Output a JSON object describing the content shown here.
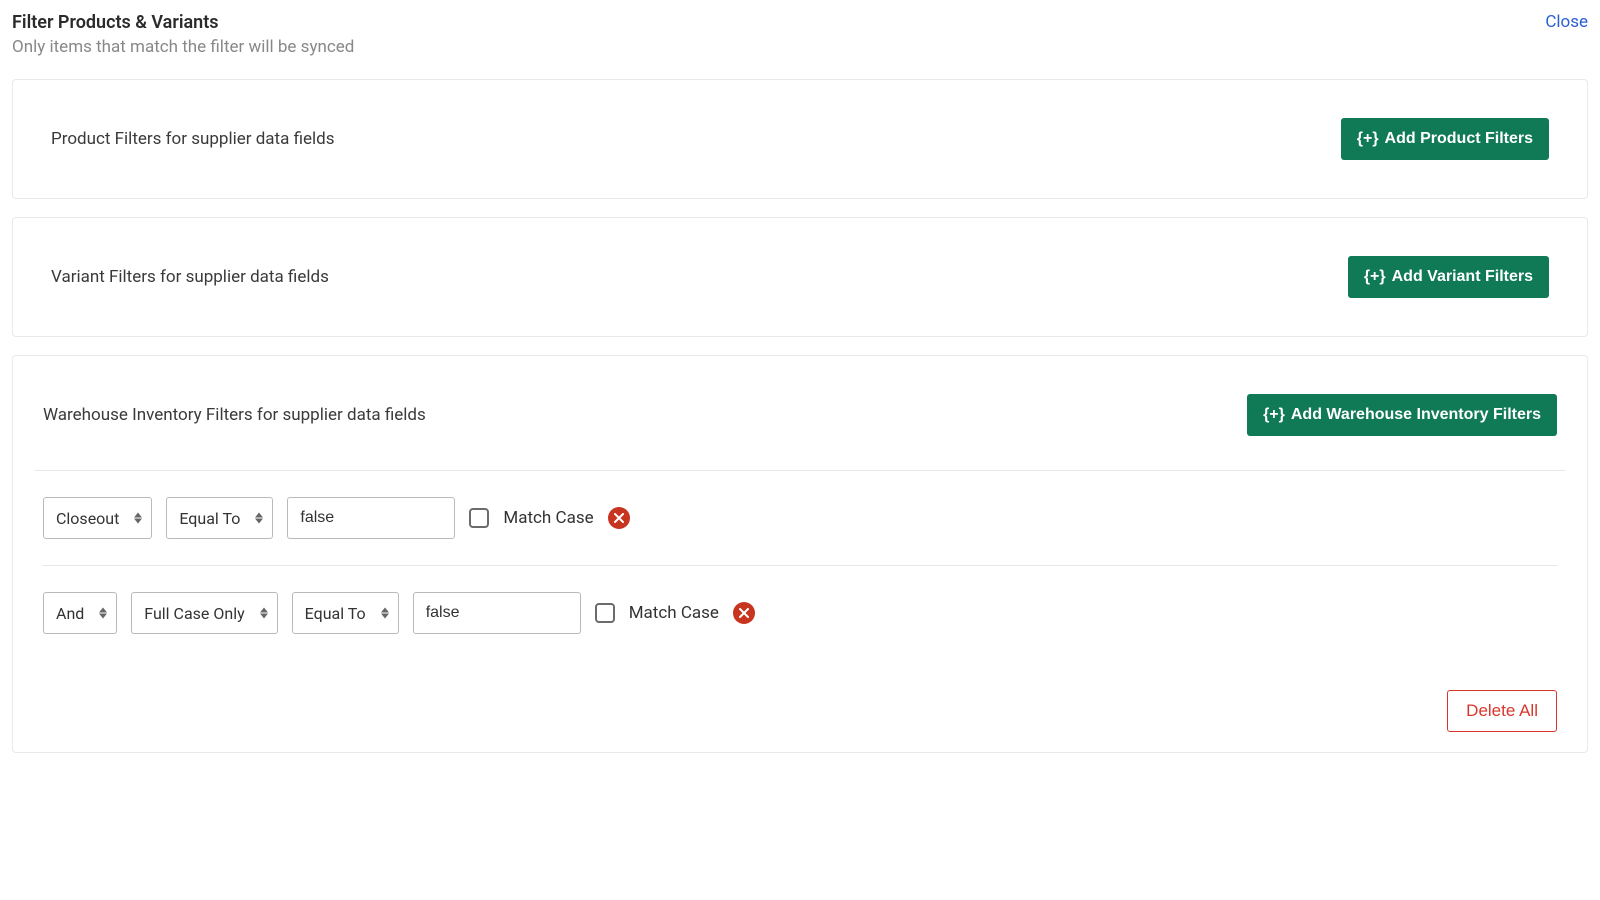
{
  "header": {
    "title": "Filter Products & Variants",
    "close": "Close",
    "subtitle": "Only items that match the filter will be synced"
  },
  "product_section": {
    "title": "Product Filters for supplier data fields",
    "add_label": "Add Product Filters",
    "add_prefix": "{+}"
  },
  "variant_section": {
    "title": "Variant Filters for supplier data fields",
    "add_label": "Add Variant Filters",
    "add_prefix": "{+}"
  },
  "inventory_section": {
    "title": "Warehouse Inventory Filters for supplier data fields",
    "add_label": "Add Warehouse Inventory Filters",
    "add_prefix": "{+}",
    "rows": [
      {
        "field": "Closeout",
        "operator": "Equal To",
        "value": "false",
        "match_case_label": "Match Case",
        "match_case_checked": false
      },
      {
        "logic": "And",
        "field": "Full Case Only",
        "operator": "Equal To",
        "value": "false",
        "match_case_label": "Match Case",
        "match_case_checked": false
      }
    ],
    "delete_all": "Delete All"
  }
}
